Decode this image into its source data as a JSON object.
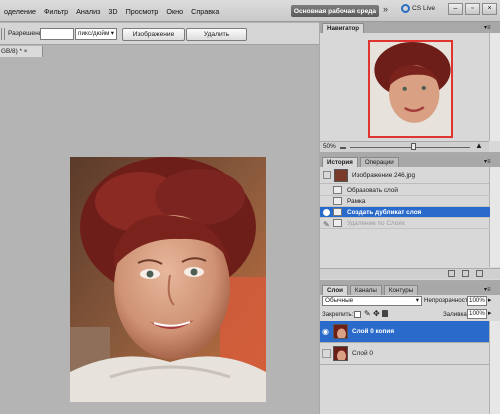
{
  "menu": {
    "items": [
      "оделение",
      "Фильтр",
      "Анализ",
      "3D",
      "Просмотр",
      "Окно",
      "Справка"
    ]
  },
  "workspace": {
    "label": "Основная рабочая среда",
    "more": "»"
  },
  "cs_live": {
    "label": "CS Live"
  },
  "window_controls": {
    "minimize": "–",
    "restore": "▫",
    "close": "×"
  },
  "options": {
    "resolution_label": "Разрешение:",
    "resolution_value": "",
    "units": "пикс/дюйм",
    "image_button": "Изображение",
    "delete_button": "Удалить"
  },
  "document": {
    "tab_label": "GB/8) * ",
    "tab_close": "×"
  },
  "navigator": {
    "tab": "Навигатор",
    "zoom": "50%"
  },
  "history": {
    "tabs": [
      "История",
      "Операции"
    ],
    "snapshot": "Изображение 246.jpg",
    "steps": [
      {
        "label": "Образовать слой",
        "state": "normal"
      },
      {
        "label": "Рамка",
        "state": "normal"
      },
      {
        "label": "Создать дубликат слоя",
        "state": "selected"
      },
      {
        "label": "Удаление по Слоях",
        "state": "dim"
      }
    ]
  },
  "layers": {
    "tabs": [
      "Слои",
      "Каналы",
      "Контуры"
    ],
    "blend_mode": "Обычные",
    "opacity_label": "Непрозрачность:",
    "opacity_value": "100%",
    "lock_label": "Закрепить:",
    "fill_label": "Заливка:",
    "fill_value": "100%",
    "items": [
      {
        "name": "Слой 0 копия",
        "visible": true,
        "selected": true
      },
      {
        "name": "Слой 0",
        "visible": false,
        "selected": false
      }
    ]
  },
  "colors": {
    "selection": "#2a6acb",
    "navigator_frame": "#e0352e",
    "workspace_bg": "#b4b4b4"
  }
}
